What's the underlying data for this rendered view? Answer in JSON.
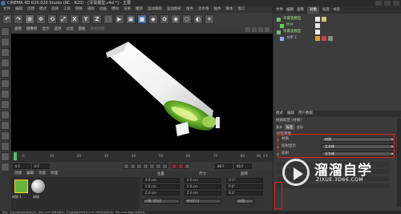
{
  "window": {
    "title": "CINEMA 4D R20.026 Studio (RC - R20) - [牙膏模型.c4d *] - 主要"
  },
  "menu": {
    "items": [
      "文件",
      "编辑",
      "创建",
      "模式",
      "选择",
      "工具",
      "网格",
      "捕捉",
      "动画",
      "模拟",
      "渲染",
      "雕刻",
      "运动跟踪",
      "运动图形",
      "角色",
      "流水线",
      "插件",
      "脚本",
      "窗口"
    ]
  },
  "toolbar": {
    "buttons": [
      "↶",
      "↷",
      "⊕",
      "✥",
      "⟲",
      "⤢",
      "X",
      "Y",
      "Z",
      "⬚",
      "▶",
      "▣",
      "■",
      "◆",
      "✿",
      "◉",
      "⬡",
      "◐",
      "☀"
    ]
  },
  "viewport": {
    "menu": [
      "查看",
      "摄像机",
      "显示",
      "选项",
      "过滤",
      "面板"
    ],
    "label": "透视视图"
  },
  "timeline": {
    "ticks": [
      "0",
      "10",
      "20",
      "30",
      "40",
      "50",
      "60",
      "70",
      "80",
      "90"
    ],
    "end_frame": "0 F"
  },
  "transport": {
    "start": "0 F",
    "current": "0 F",
    "end": "90 F",
    "end2": "90 F"
  },
  "materials": {
    "tabs": [
      "创建",
      "编辑",
      "功能",
      "纹理"
    ],
    "items": [
      "材质 1",
      "材质"
    ]
  },
  "coordinates": {
    "headers": [
      "位置",
      "尺寸",
      "旋转"
    ],
    "rows": [
      {
        "pos": "X  0 cm",
        "size": "X  0 cm",
        "rot": "H  0°"
      },
      {
        "pos": "Y  0 cm",
        "size": "Y  0 cm",
        "rot": "P  0°"
      },
      {
        "pos": "Z  0 cm",
        "size": "Z  0 cm",
        "rot": "B  0°"
      }
    ],
    "mode": "对象 (相对)",
    "size_mode": "绝对尺寸",
    "apply": "应用"
  },
  "objects": {
    "tabs": [
      "文件",
      "编辑",
      "查看",
      "对象",
      "标签",
      "书签"
    ],
    "active_tab": "对象",
    "rows": [
      {
        "label": "牙膏管模型",
        "color": "#6bc46b",
        "tag_colors": [
          "#e8e8e8",
          "#d8c070"
        ]
      },
      {
        "label": "叶片",
        "color": "#6bc46b",
        "tag_colors": [
          "#e8e8e8"
        ]
      },
      {
        "label": "牙膏盖模型",
        "color": "#6bc46b",
        "tag_colors": [
          "#e8e8e8"
        ]
      },
      {
        "label": "文字 1",
        "color": "#8ab0e0",
        "tag_colors": [
          "#e0a030",
          "#cc4444",
          "#888888"
        ]
      }
    ]
  },
  "attributes": {
    "tabs": [
      "模式",
      "编辑",
      "用户数据"
    ],
    "header": "材质标签 [材质]",
    "subtabs": [
      "基本",
      "标签",
      "坐标"
    ],
    "active_subtab": "标签",
    "section": "标签属性",
    "rows": [
      {
        "label": "材质",
        "value": "材质"
      },
      {
        "label": "投射显示",
        "value": "立方体"
      },
      {
        "label": "投射",
        "value": "立方体"
      }
    ]
  },
  "status": {
    "text": "移动：点击并拖动鼠标移动元素。按住 SHIFT 键量化移动；节点编辑模式时按住 SHIFT 键增加选择对象；按住 CTRL 键减少选择对象。"
  },
  "watermark": {
    "title": "溜溜自学",
    "url": "ZIXUE.3D66.COM"
  },
  "colors": {
    "accent": "#e02020",
    "panel": "#3a3a3a",
    "viewport": "#000000"
  }
}
